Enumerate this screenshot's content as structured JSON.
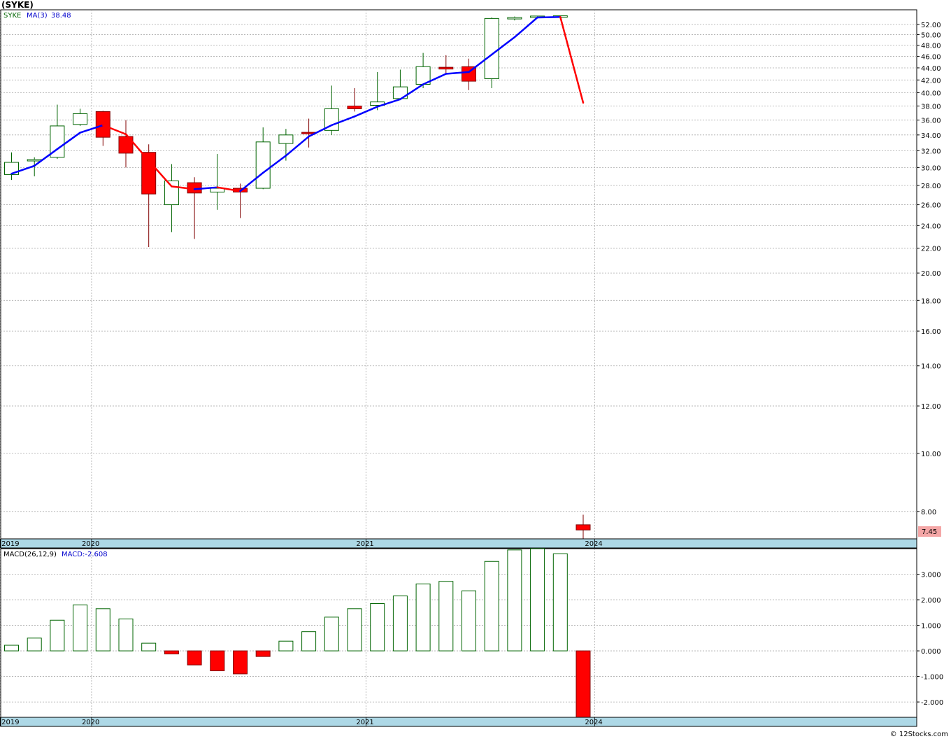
{
  "title": "(SYKE)",
  "footer": "© 12Stocks.com",
  "price_panel": {
    "legend_symbol": "SYKE",
    "legend_ma": "MA(3)",
    "legend_ma_value": "38.48",
    "last_price_label": "7.45",
    "ytick_labels": [
      "52.00",
      "50.00",
      "48.00",
      "46.00",
      "44.00",
      "42.00",
      "40.00",
      "38.00",
      "36.00",
      "34.00",
      "32.00",
      "30.00",
      "28.00",
      "26.00",
      "24.00",
      "22.00",
      "20.00",
      "18.00",
      "16.00",
      "14.00",
      "12.00",
      "10.00",
      "8.00"
    ]
  },
  "macd_panel": {
    "legend_name": "MACD(26,12,9)",
    "legend_value": "MACD:-2.608",
    "ytick_labels": [
      "3.000",
      "2.000",
      "1.000",
      "0.000",
      "-1.000",
      "-2.000"
    ]
  },
  "year_labels": [
    "2019",
    "2020",
    "2021",
    "2024"
  ],
  "colors": {
    "up": "#006400",
    "down": "#ff0000",
    "ma_up": "#0000ff",
    "ma_down": "#ff0000",
    "axis_band": "#add8e6",
    "grid": "#aaaaaa",
    "last_price_bg": "#f4a6a6"
  },
  "chart_data": [
    {
      "type": "candlestick",
      "scale": "log",
      "ylim": [
        7.2,
        55
      ],
      "yticks": [
        52,
        50,
        48,
        46,
        44,
        42,
        40,
        38,
        36,
        34,
        32,
        30,
        28,
        26,
        24,
        22,
        20,
        18,
        16,
        14,
        12,
        10,
        8
      ],
      "grid": true,
      "x_year_labels": [
        {
          "label": "2019",
          "index": -0.5
        },
        {
          "label": "2020",
          "index": 3.5
        },
        {
          "label": "2021",
          "index": 15.5
        },
        {
          "label": "2024",
          "index": 25.5
        }
      ],
      "candles": [
        {
          "o": 29.2,
          "h": 31.8,
          "l": 28.6,
          "c": 30.6
        },
        {
          "o": 30.8,
          "h": 31.2,
          "l": 29.0,
          "c": 30.9
        },
        {
          "o": 31.2,
          "h": 38.2,
          "l": 31.0,
          "c": 35.2
        },
        {
          "o": 35.4,
          "h": 37.6,
          "l": 35.2,
          "c": 36.9
        },
        {
          "o": 37.2,
          "h": 37.3,
          "l": 32.6,
          "c": 33.7
        },
        {
          "o": 33.8,
          "h": 36.0,
          "l": 30.0,
          "c": 31.7
        },
        {
          "o": 31.8,
          "h": 32.8,
          "l": 22.1,
          "c": 27.1
        },
        {
          "o": 26.0,
          "h": 30.4,
          "l": 23.4,
          "c": 28.5
        },
        {
          "o": 28.3,
          "h": 28.9,
          "l": 22.8,
          "c": 27.2
        },
        {
          "o": 27.3,
          "h": 31.6,
          "l": 25.5,
          "c": 27.7
        },
        {
          "o": 27.7,
          "h": 28.2,
          "l": 24.7,
          "c": 27.3
        },
        {
          "o": 27.7,
          "h": 35.0,
          "l": 27.6,
          "c": 33.1
        },
        {
          "o": 32.9,
          "h": 34.8,
          "l": 30.8,
          "c": 34.0
        },
        {
          "o": 34.3,
          "h": 36.2,
          "l": 32.4,
          "c": 34.2
        },
        {
          "o": 34.6,
          "h": 41.1,
          "l": 34.0,
          "c": 37.6
        },
        {
          "o": 38.0,
          "h": 40.7,
          "l": 37.2,
          "c": 37.6
        },
        {
          "o": 38.1,
          "h": 43.3,
          "l": 37.4,
          "c": 38.6
        },
        {
          "o": 39.1,
          "h": 43.7,
          "l": 38.9,
          "c": 40.9
        },
        {
          "o": 41.3,
          "h": 46.6,
          "l": 40.7,
          "c": 44.2
        },
        {
          "o": 44.1,
          "h": 46.2,
          "l": 43.1,
          "c": 43.8
        },
        {
          "o": 44.2,
          "h": 45.6,
          "l": 40.4,
          "c": 41.8
        },
        {
          "o": 42.2,
          "h": 53.4,
          "l": 40.7,
          "c": 53.2
        },
        {
          "o": 53.1,
          "h": 53.6,
          "l": 52.8,
          "c": 53.4
        },
        {
          "o": 53.5,
          "h": 53.7,
          "l": 53.4,
          "c": 53.6
        },
        {
          "o": 53.6,
          "h": 53.7,
          "l": 53.5,
          "c": 53.6
        },
        {
          "o": 7.6,
          "h": 7.9,
          "l": 7.2,
          "c": 7.45
        }
      ],
      "ma3": [
        29.3,
        30.2,
        32.2,
        34.3,
        35.3,
        34.1,
        30.8,
        27.9,
        27.6,
        27.8,
        27.4,
        29.4,
        31.4,
        33.8,
        35.3,
        36.5,
        37.9,
        39.0,
        41.3,
        43.0,
        43.3,
        46.3,
        49.5,
        53.4,
        53.5,
        38.48
      ]
    },
    {
      "type": "bar",
      "ylim": [
        -2.6,
        4.0
      ],
      "yticks": [
        3,
        2,
        1,
        0,
        -1,
        -2
      ],
      "grid": true,
      "values": [
        0.22,
        0.5,
        1.2,
        1.8,
        1.65,
        1.25,
        0.3,
        -0.12,
        -0.55,
        -0.78,
        -0.9,
        -0.22,
        0.38,
        0.75,
        1.32,
        1.65,
        1.85,
        2.15,
        2.62,
        2.72,
        2.35,
        3.5,
        3.95,
        4.0,
        3.8,
        -2.608
      ]
    }
  ]
}
